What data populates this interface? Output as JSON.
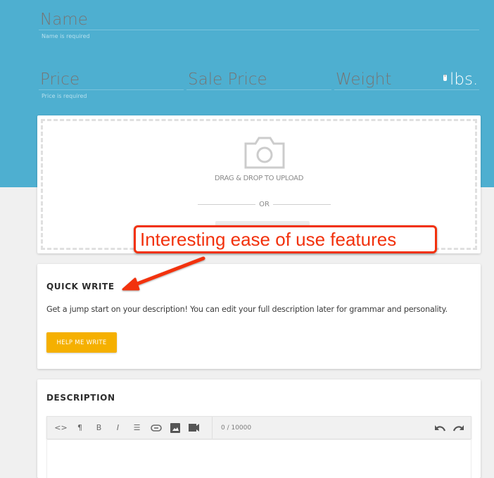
{
  "form": {
    "name": {
      "placeholder": "Name",
      "hint": "Name is required"
    },
    "price": {
      "placeholder": "Price",
      "hint": "Price is required"
    },
    "sale_price": {
      "placeholder": "Sale Price"
    },
    "weight": {
      "placeholder": "Weight",
      "unit": "lbs."
    }
  },
  "upload": {
    "icon": "camera-icon",
    "drag_text": "DRAG & DROP TO UPLOAD",
    "or_text": "OR"
  },
  "annotation": {
    "text": "Interesting ease of use features",
    "color": "#f2310c"
  },
  "quick_write": {
    "title": "QUICK WRITE",
    "description": "Get a jump start on your description! You can edit your full description later for grammar and personality.",
    "button_label": "HELP ME WRITE",
    "button_color": "#f5b000"
  },
  "description": {
    "title": "DESCRIPTION",
    "toolbar": [
      {
        "name": "code-icon",
        "glyph": "<>"
      },
      {
        "name": "paragraph-icon",
        "glyph": "¶"
      },
      {
        "name": "bold-icon",
        "glyph": "B"
      },
      {
        "name": "italic-icon",
        "glyph": "I"
      },
      {
        "name": "list-icon",
        "glyph": "☰"
      },
      {
        "name": "link-icon",
        "glyph": "⊖"
      },
      {
        "name": "image-icon",
        "glyph": "▲"
      },
      {
        "name": "video-icon",
        "glyph": "■"
      }
    ],
    "counter": "0 / 10000",
    "undo_icon": "undo-icon",
    "redo_icon": "redo-icon"
  },
  "colors": {
    "header_bg": "#4eafd0",
    "page_bg": "#f0f0f0"
  }
}
